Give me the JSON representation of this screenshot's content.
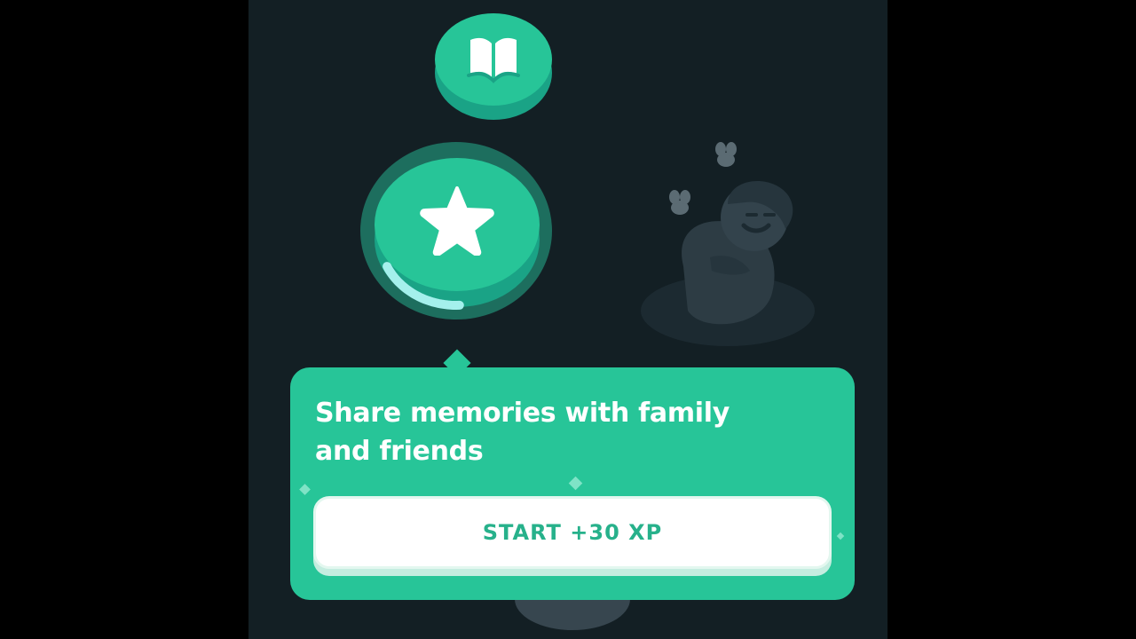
{
  "path": {
    "story_node": {
      "icon": "open-book-icon"
    },
    "lesson_node": {
      "icon": "star-icon",
      "progress": 0.25
    },
    "character": {
      "icon": "sleeping-character"
    },
    "next_node": {
      "icon": "locked-node"
    }
  },
  "popup": {
    "title": "Share memories with family and friends",
    "start_label": "START +30 XP"
  },
  "colors": {
    "background": "#131f24",
    "accent": "#27c598",
    "accent_dark": "#1aa386",
    "progress": "#a4f0ec",
    "button_text": "#27b18b"
  }
}
